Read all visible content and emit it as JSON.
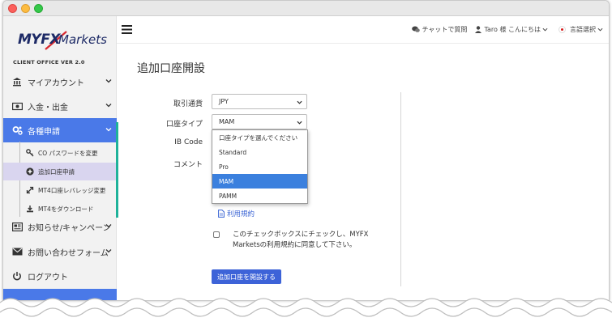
{
  "sidebar": {
    "logo_myfx": "MYFX",
    "logo_markets": "Markets",
    "version": "CLIENT OFFICE VER 2.0",
    "items": [
      {
        "label": "マイアカウント"
      },
      {
        "label": "入金・出金"
      },
      {
        "label": "各種申請"
      },
      {
        "label": "お知らせ/キャンペーン"
      },
      {
        "label": "お問い合わせフォーム"
      },
      {
        "label": "ログアウト"
      }
    ],
    "subitems": [
      {
        "label": "CO パスワードを変更"
      },
      {
        "label": "追加口座申請"
      },
      {
        "label": "MT4口座レバレッジ変更"
      },
      {
        "label": "MT4をダウンロード"
      }
    ]
  },
  "topbar": {
    "chat": "チャットで質問",
    "user": "Taro 様 こんにちは",
    "language": "言語選択"
  },
  "main": {
    "title": "追加口座開設",
    "currency_label": "取引通貨",
    "currency_value": "JPY",
    "account_type_label": "口座タイプ",
    "account_type_value": "MAM",
    "ib_code_label": "IB Code",
    "comment_label": "コメント",
    "account_type_options": [
      "口座タイプを選んでください",
      "Standard",
      "Pro",
      "MAM",
      "PAMM"
    ],
    "highlighted_option": "MAM",
    "terms_link": "利用規約",
    "agree_text": "このチェックボックスにチェックし、MYFX Marketsの利用規約に同意して下さい。",
    "submit_label": "追加口座を開設する"
  },
  "colors": {
    "accent": "#4a79e8",
    "sub_selected": "#d9d5ef",
    "teal": "#1fb29a",
    "option_highlight": "#3b80de"
  }
}
